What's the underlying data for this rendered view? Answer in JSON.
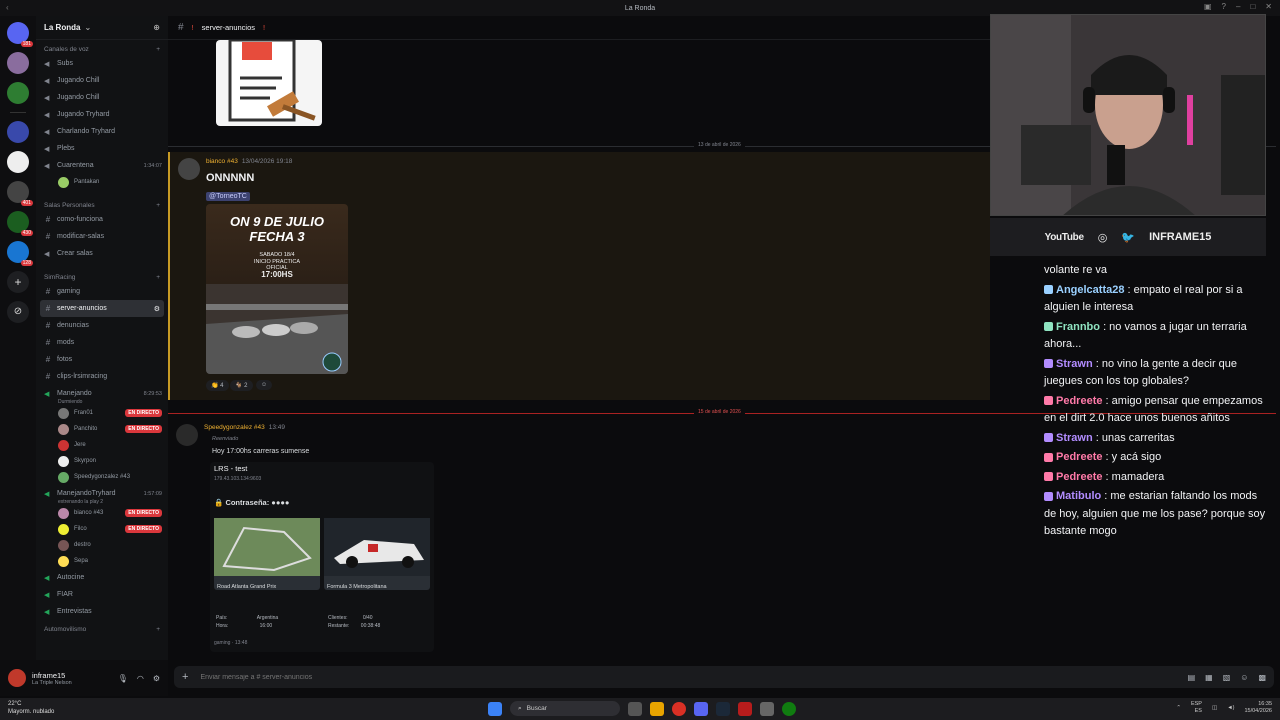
{
  "window": {
    "title": "La Ronda"
  },
  "server": {
    "name": "La Ronda"
  },
  "rail_badges": [
    "181",
    "401",
    "430",
    "128"
  ],
  "sidebar": {
    "voice_category": "Canales de voz",
    "voice_channels": [
      {
        "label": "Subs"
      },
      {
        "label": "Jugando Chill"
      },
      {
        "label": "Jugando Chill"
      },
      {
        "label": "Jugando Tryhard"
      },
      {
        "label": "Charlando Tryhard"
      },
      {
        "label": "Plebs"
      },
      {
        "label": "Cuarentena",
        "time": "1:34:07"
      }
    ],
    "cuarentena_user": "Pantakan",
    "personal_category": "Salas Personales",
    "personal_channels": [
      "como-funciona",
      "modificar-salas",
      "Crear salas"
    ],
    "simracing_category": "SimRacing",
    "simracing_channels": [
      {
        "label": "gaming"
      },
      {
        "label": "server-anuncios",
        "active": true
      },
      {
        "label": "denuncias"
      },
      {
        "label": "mods"
      },
      {
        "label": "fotos"
      },
      {
        "label": "clips-lrsimracing"
      }
    ],
    "manejando": {
      "label": "Manejando",
      "time": "8:29:53",
      "subtitle": "Durmiendo"
    },
    "manejando_users": [
      {
        "name": "Fran01",
        "live": true
      },
      {
        "name": "Panchito",
        "live": true
      },
      {
        "name": "Jere",
        "live": false
      },
      {
        "name": "Skyrpon",
        "live": false
      },
      {
        "name": "Speedygonzalez #43",
        "live": false
      }
    ],
    "tryhard": {
      "label": "ManejandoTryhard",
      "time": "1:57:09",
      "subtitle": "extrenando la play 2"
    },
    "tryhard_users": [
      {
        "name": "bianco #43",
        "live": true
      },
      {
        "name": "Filco",
        "live": true
      },
      {
        "name": "destro",
        "live": false
      },
      {
        "name": "Sepa",
        "live": false
      }
    ],
    "other_channels": [
      "Autocine",
      "FIAR",
      "Entrevistas"
    ],
    "auto_category": "Automovilismo",
    "live_label": "EN DIRECTO"
  },
  "user_panel": {
    "name": "inframe15",
    "status": "La Triple Nelson"
  },
  "chat_header": {
    "channel": "server-anuncios"
  },
  "messages": {
    "date1": "13 de abril de 2026",
    "m1": {
      "author": "bianco #43",
      "timestamp": "13/04/2026 19:18",
      "text": "ONNNNN",
      "mention": "@TorneoTC",
      "poster_lines": [
        "ON 9 DE JULIO",
        "FECHA 3"
      ],
      "poster_sub": [
        "SABADO 18/4",
        "INICIO PRACTICA",
        "OFICIAL",
        "17:00HS"
      ],
      "reactions": [
        {
          "emoji": "👏",
          "count": "4"
        },
        {
          "emoji": "🐐",
          "count": "2"
        }
      ]
    },
    "date2": "15 de abril de 2026",
    "new_label": "NUEVO",
    "m2": {
      "author": "Speedygonzalez #43",
      "timestamp": "13:49",
      "forwarded": "Reenviado",
      "text": "Hoy 17:00hs carreras sumense",
      "server_title": "LRS - test",
      "server_ip": "179.43.103.134:9603",
      "password_label": "Contraseña:",
      "password_value": "●●●●",
      "track_name": "Road Atlanta Grand Prix",
      "car_name": "Formula 3 Metropolitana",
      "country_label": "País:",
      "country_value": "Argentina",
      "time_label": "Hora:",
      "time_value": "16:00",
      "clients_label": "Clientes:",
      "clients_value": "0/40",
      "remaining_label": "Restante:",
      "remaining_value": "00:38:48",
      "footer": "gaming · 13:48"
    }
  },
  "input": {
    "placeholder": "Enviar mensaje a # server-anuncios"
  },
  "stream": {
    "socials": {
      "youtube": "YouTube",
      "handle": "INFRAME15"
    },
    "chat": [
      {
        "user": "",
        "text": "volante re va",
        "color": "#f2f3f5"
      },
      {
        "user": "Angelcatta28",
        "text": ": empato el real por si a alguien le interesa",
        "color": "#9ad0ff"
      },
      {
        "user": "Frannbo",
        "text": ": no vamos a jugar un terraria ahora...",
        "color": "#8fe3c0"
      },
      {
        "user": "Strawn",
        "text": ": no vino la gente a decir que juegues con los top globales?",
        "color": "#b28cff"
      },
      {
        "user": "Pedreete",
        "text": ": amigo pensar que empezamos en el dirt 2.0 hace unos buenos añitos",
        "color": "#ff7aa8"
      },
      {
        "user": "Strawn",
        "text": ": unas carreritas",
        "color": "#b28cff"
      },
      {
        "user": "Pedreete",
        "text": ": y acá sigo",
        "color": "#ff7aa8"
      },
      {
        "user": "Pedreete",
        "text": ": mamadera",
        "color": "#ff7aa8"
      },
      {
        "user": "Matibulo",
        "text": ": me estarian faltando los mods de hoy, alguien que me los pase? porque soy bastante mogo",
        "color": "#b28cff"
      }
    ]
  },
  "taskbar": {
    "temp": "22°C",
    "weather": "Mayorm. nublado",
    "search": "Buscar",
    "lang": "ESP",
    "lang2": "ES",
    "time": "16:35",
    "date": "15/04/2026"
  },
  "colors": {
    "accent": "#5865f2",
    "live": "#da373c",
    "highlight": "#c79a24"
  }
}
